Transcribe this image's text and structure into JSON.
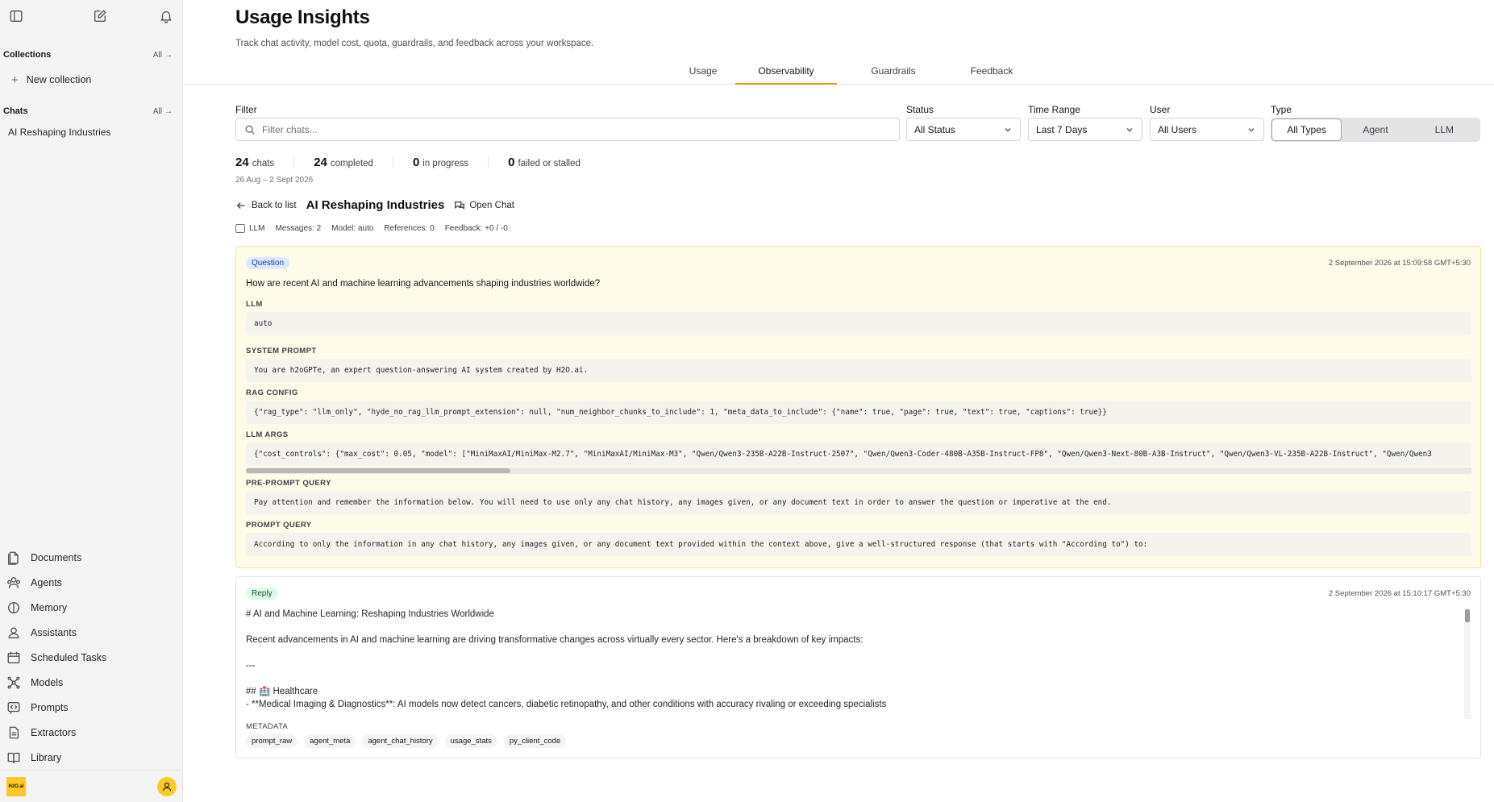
{
  "sidebar": {
    "collections_title": "Collections",
    "collections_all": "All",
    "new_collection": "New collection",
    "chats_title": "Chats",
    "chats_all": "All",
    "chats": [
      "AI Reshaping Industries"
    ],
    "nav": [
      {
        "label": "Documents",
        "icon": "document-icon"
      },
      {
        "label": "Agents",
        "icon": "agents-icon"
      },
      {
        "label": "Memory",
        "icon": "memory-icon"
      },
      {
        "label": "Assistants",
        "icon": "assistant-icon"
      },
      {
        "label": "Scheduled Tasks",
        "icon": "calendar-icon"
      },
      {
        "label": "Models",
        "icon": "models-icon"
      },
      {
        "label": "Prompts",
        "icon": "prompt-icon"
      },
      {
        "label": "Extractors",
        "icon": "extractor-icon"
      },
      {
        "label": "Library",
        "icon": "library-icon"
      }
    ],
    "logo_text": "H2O.ai"
  },
  "header": {
    "title": "Usage Insights",
    "subtitle": "Track chat activity, model cost, quota, guardrails, and feedback across your workspace."
  },
  "tabs": [
    {
      "label": "Usage",
      "active": false
    },
    {
      "label": "Observability",
      "active": true
    },
    {
      "label": "Guardrails",
      "active": false
    },
    {
      "label": "Feedback",
      "active": false
    }
  ],
  "filters": {
    "filter_label": "Filter",
    "filter_placeholder": "Filter chats...",
    "status_label": "Status",
    "status_value": "All Status",
    "time_label": "Time Range",
    "time_value": "Last 7 Days",
    "user_label": "User",
    "user_value": "All Users",
    "type_label": "Type",
    "type_options": [
      "All Types",
      "Agent",
      "LLM"
    ],
    "type_selected": "All Types"
  },
  "stats": {
    "chats_count": "24",
    "chats_label": "chats",
    "completed_count": "24",
    "completed_label": "completed",
    "progress_count": "0",
    "progress_label": "in progress",
    "failed_count": "0",
    "failed_label": "failed or stalled",
    "date_range": "26 Aug – 2 Sept 2026"
  },
  "detail": {
    "back_label": "Back to list",
    "title": "AI Reshaping Industries",
    "open_chat": "Open Chat",
    "meta": {
      "type": "LLM",
      "messages": "Messages: 2",
      "model": "Model: auto",
      "references": "References: 0",
      "feedback": "Feedback: +0 / -0"
    }
  },
  "question": {
    "badge": "Question",
    "timestamp": "2 September 2026 at 15:09:58 GMT+5:30",
    "text": "How are recent AI and machine learning advancements shaping industries worldwide?",
    "llm_label": "LLM",
    "llm_value": "auto",
    "system_prompt_label": "SYSTEM PROMPT",
    "system_prompt": "You are h2oGPTe, an expert question-answering AI system created by H2O.ai.",
    "rag_config_label": "RAG CONFIG",
    "rag_config": "{\"rag_type\": \"llm_only\", \"hyde_no_rag_llm_prompt_extension\": null, \"num_neighbor_chunks_to_include\": 1, \"meta_data_to_include\": {\"name\": true, \"page\": true, \"text\": true, \"captions\": true}}",
    "llm_args_label": "LLM ARGS",
    "llm_args": "{\"cost_controls\": {\"max_cost\": 0.05, \"model\": [\"MiniMaxAI/MiniMax-M2.7\", \"MiniMaxAI/MiniMax-M3\", \"Qwen/Qwen3-235B-A22B-Instruct-2507\", \"Qwen/Qwen3-Coder-480B-A35B-Instruct-FP8\", \"Qwen/Qwen3-Next-80B-A3B-Instruct\", \"Qwen/Qwen3-VL-235B-A22B-Instruct\", \"Qwen/Qwen3",
    "pre_prompt_label": "PRE-PROMPT QUERY",
    "pre_prompt": "Pay attention and remember the information below. You will need to use only any chat history, any images given, or any document text in order to answer the question or imperative at the end.",
    "prompt_query_label": "PROMPT QUERY",
    "prompt_query": "According to only the information in any chat history, any images given, or any document text provided within the context above, give a well-structured response (that starts with \"According to\") to:"
  },
  "reply": {
    "badge": "Reply",
    "timestamp": "2 September 2026 at 15:10:17 GMT+5:30",
    "line1": "# AI and Machine Learning: Reshaping Industries Worldwide",
    "line2": "Recent advancements in AI and machine learning are driving transformative changes across virtually every sector. Here's a breakdown of key impacts:",
    "line3": "---",
    "line4": "## 🏥 Healthcare",
    "line5": "- **Medical Imaging & Diagnostics**: AI models now detect cancers, diabetic retinopathy, and other conditions with accuracy rivaling or exceeding specialists",
    "metadata_label": "METADATA",
    "metadata_chips": [
      "prompt_raw",
      "agent_meta",
      "agent_chat_history",
      "usage_stats",
      "py_client_code"
    ]
  },
  "colors": {
    "accent": "#d4a017",
    "question_bg": "#fefbe8",
    "brand": "#fec925"
  }
}
